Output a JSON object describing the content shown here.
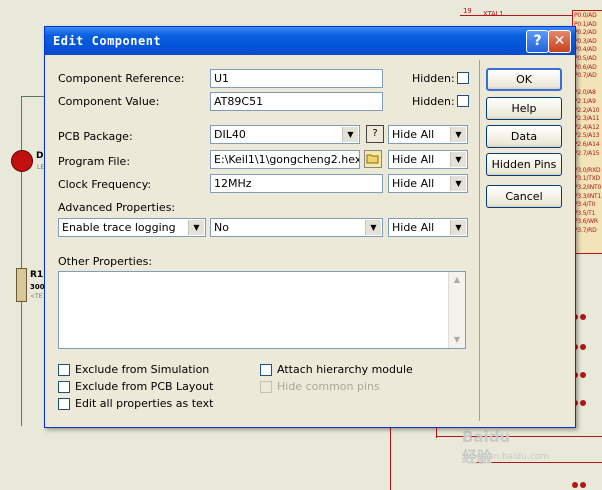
{
  "background": {
    "net_label": "XTAL1",
    "net_number": "19",
    "pin_labels": [
      "P0.0/AD",
      "P0.1/AD",
      "P0.2/AD",
      "P0.3/AD",
      "P0.4/AD",
      "P0.5/AD",
      "P0.6/AD",
      "P0.7/AD",
      "",
      "P2.0/A8",
      "P2.1/A9",
      "P2.2/A10",
      "P2.3/A11",
      "P2.4/A12",
      "P2.5/A13",
      "P2.6/A14",
      "P2.7/A15",
      "",
      "P3.0/RXD",
      "P3.1/TXD",
      "P3.2/INT0",
      "P3.3/INT1",
      "P3.4/T0",
      "P3.5/T1",
      "P3.6/WR",
      "P3.7/RD"
    ],
    "d_label": "D",
    "d_sub": "LE",
    "r_label": "R1",
    "r_value": "300",
    "r_sub": "<TE",
    "watermark": "Baidu 经验",
    "watermark_url": "jingyan.baidu.com"
  },
  "dialog": {
    "title": "Edit Component",
    "help_glyph": "?",
    "close_glyph": "✕",
    "component_reference": {
      "label": "Component Reference:",
      "value": "U1",
      "hidden_label": "Hidden:"
    },
    "component_value": {
      "label": "Component Value:",
      "value": "AT89C51",
      "hidden_label": "Hidden:"
    },
    "pcb_package": {
      "label": "PCB Package:",
      "value": "DIL40",
      "help_glyph": "?",
      "visibility": "Hide All"
    },
    "program_file": {
      "label": "Program File:",
      "value": "E:\\Keil1\\1\\gongcheng2.hex",
      "visibility": "Hide All"
    },
    "clock_frequency": {
      "label": "Clock Frequency:",
      "value": "12MHz",
      "visibility": "Hide All"
    },
    "advanced_properties": {
      "label": "Advanced Properties:",
      "property": "Enable trace logging",
      "value": "No",
      "visibility": "Hide All"
    },
    "other_properties": {
      "label": "Other Properties:",
      "value": ""
    },
    "checkboxes": [
      {
        "label": "Exclude from Simulation",
        "checked": false,
        "enabled": true
      },
      {
        "label": "Exclude from PCB Layout",
        "checked": false,
        "enabled": true
      },
      {
        "label": "Edit all properties as text",
        "checked": false,
        "enabled": true
      },
      {
        "label": "Attach hierarchy module",
        "checked": false,
        "enabled": true
      },
      {
        "label": "Hide common pins",
        "checked": false,
        "enabled": false
      }
    ],
    "buttons": {
      "ok": "OK",
      "help": "Help",
      "data": "Data",
      "hidden_pins": "Hidden Pins",
      "cancel": "Cancel"
    },
    "arrow_glyph": "▼",
    "folder_icon": "folder-icon"
  }
}
